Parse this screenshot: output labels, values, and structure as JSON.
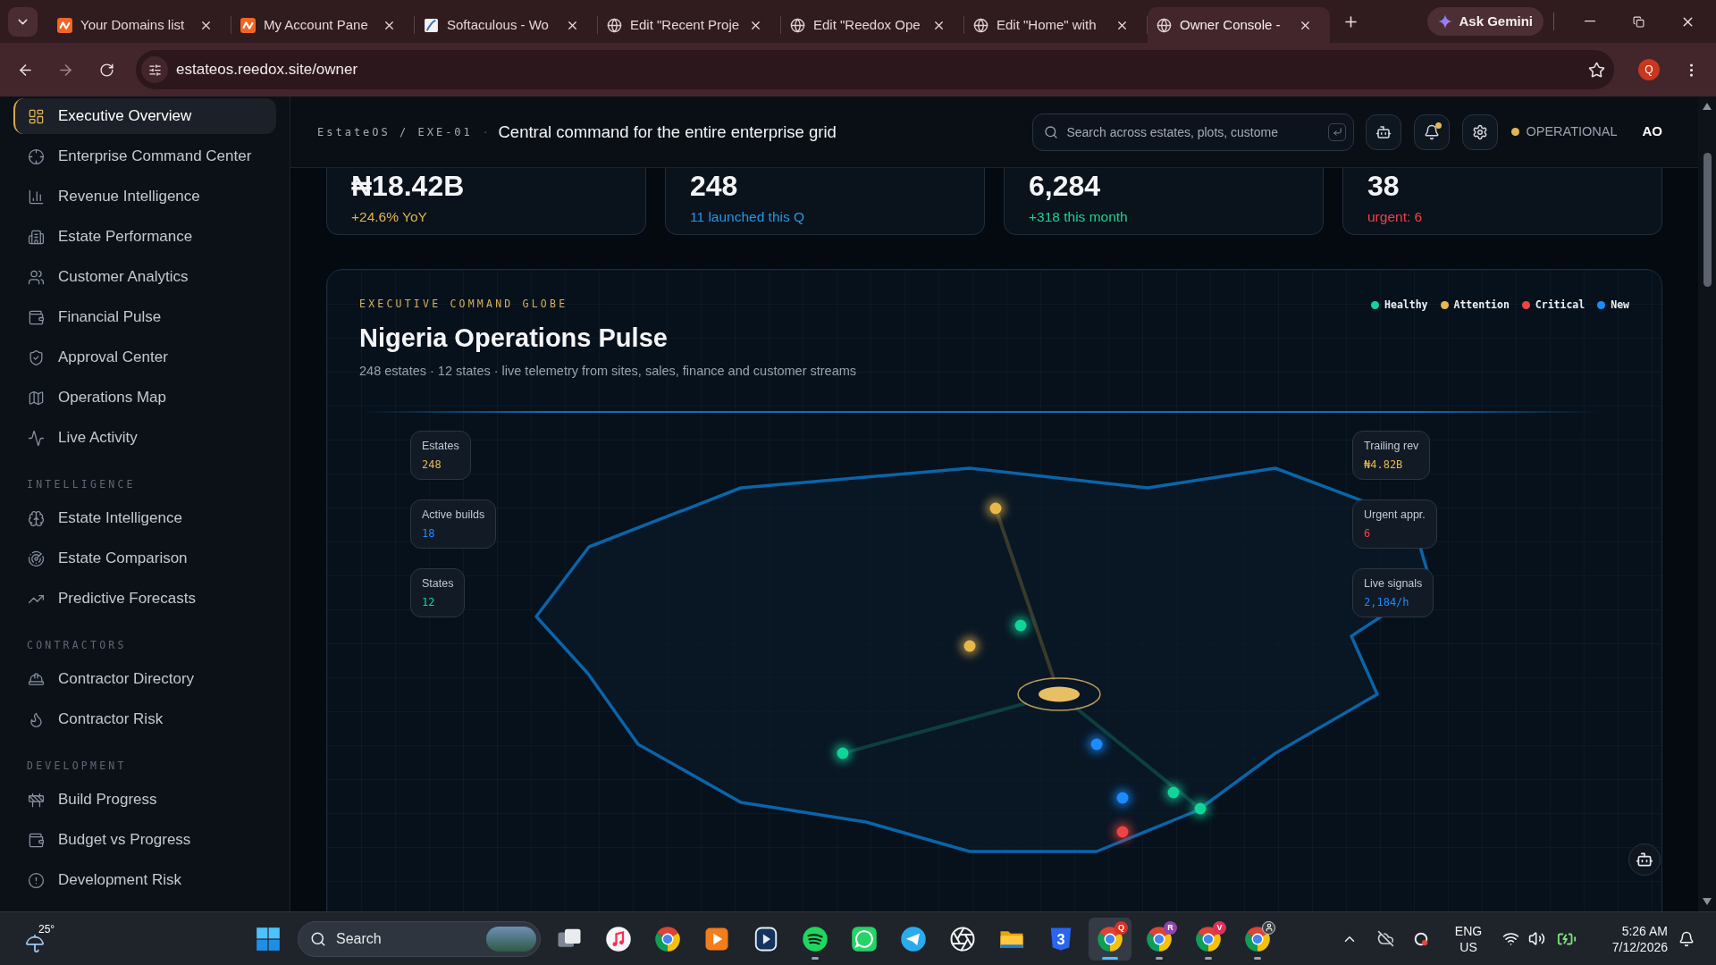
{
  "browser": {
    "tabs": [
      {
        "title": "Your Domains list",
        "kind": "logo",
        "selected": false
      },
      {
        "title": "My Account Pane",
        "kind": "logo",
        "selected": false
      },
      {
        "title": "Softaculous - Wo",
        "kind": "document",
        "selected": false
      },
      {
        "title": "Edit \"Recent Proje",
        "kind": "globe",
        "selected": false
      },
      {
        "title": "Edit \"Reedox Ope",
        "kind": "globe",
        "selected": false
      },
      {
        "title": "Edit \"Home\" with",
        "kind": "globe",
        "selected": false
      },
      {
        "title": "Owner Console -",
        "kind": "globe",
        "selected": true
      }
    ],
    "assistant": "Ask Gemini",
    "url": "estateos.reedox.site/owner",
    "profile": "Q"
  },
  "sidebar": {
    "groups": [
      {
        "items": [
          {
            "label": "Executive Overview",
            "selected": true
          },
          {
            "label": "Enterprise Command Center",
            "selected": false
          },
          {
            "label": "Revenue Intelligence",
            "selected": false
          },
          {
            "label": "Estate Performance",
            "selected": false
          },
          {
            "label": "Customer Analytics",
            "selected": false
          },
          {
            "label": "Financial Pulse",
            "selected": false
          },
          {
            "label": "Approval Center",
            "selected": false
          },
          {
            "label": "Operations Map",
            "selected": false
          },
          {
            "label": "Live Activity",
            "selected": false
          }
        ]
      },
      {
        "heading": "INTELLIGENCE",
        "items": [
          {
            "label": "Estate Intelligence",
            "selected": false
          },
          {
            "label": "Estate Comparison",
            "selected": false
          },
          {
            "label": "Predictive Forecasts",
            "selected": false
          }
        ]
      },
      {
        "heading": "CONTRACTORS",
        "items": [
          {
            "label": "Contractor Directory",
            "selected": false
          },
          {
            "label": "Contractor Risk",
            "selected": false
          }
        ]
      },
      {
        "heading": "DEVELOPMENT",
        "items": [
          {
            "label": "Build Progress",
            "selected": false
          },
          {
            "label": "Budget vs Progress",
            "selected": false
          },
          {
            "label": "Development Risk",
            "selected": false
          }
        ]
      }
    ]
  },
  "header": {
    "breadcrumb": "EstateOS / EXE-01",
    "separator": "·",
    "title": "Central command for the entire enterprise grid",
    "search": {
      "placeholder": "Search across estates, plots, custome"
    },
    "unread_alerts": true,
    "status": "OPERATIONAL",
    "user": "AO"
  },
  "stats": [
    {
      "value": "₦18.42B",
      "note": "+24.6% YoY",
      "color": "#e0b550"
    },
    {
      "value": "248",
      "note": "11 launched this Q",
      "color": "#2299e6"
    },
    {
      "value": "6,284",
      "note": "+318 this month",
      "color": "#1ed28f"
    },
    {
      "value": "38",
      "note": "urgent: 6",
      "color": "#ef4444"
    }
  ],
  "globe": {
    "eyebrow": "EXECUTIVE COMMAND GLOBE",
    "title": "Nigeria Operations Pulse",
    "subtitle": "248 estates · 12 states · live telemetry from sites, sales, finance and customer streams",
    "legend": [
      {
        "label": "Healthy",
        "color": "#10d49a"
      },
      {
        "label": "Attention",
        "color": "#e8b84a"
      },
      {
        "label": "Critical",
        "color": "#ef4444"
      },
      {
        "label": "New",
        "color": "#1a8cff"
      }
    ],
    "chips_left": [
      {
        "label": "Estates",
        "value": "248",
        "color": "#e8b84a"
      },
      {
        "label": "Active builds",
        "value": "18",
        "color": "#1a8cff"
      },
      {
        "label": "States",
        "value": "12",
        "color": "#10d49a"
      }
    ],
    "chips_right": [
      {
        "label": "Trailing rev",
        "value": "₦4.82B",
        "color": "#e8b84a"
      },
      {
        "label": "Urgent appr.",
        "value": "6",
        "color": "#ef4444"
      },
      {
        "label": "Live signals",
        "value": "2,184/h",
        "color": "#1a8cff"
      }
    ],
    "markers": [
      {
        "color": "#e8b84a"
      },
      {
        "color": "#10d49a"
      },
      {
        "color": "#e8b84a"
      },
      {
        "color": "#1a8cff"
      },
      {
        "color": "#10d49a"
      },
      {
        "color": "#10d49a"
      },
      {
        "color": "#1a8cff"
      },
      {
        "color": "#10d49a"
      },
      {
        "color": "#ef4444"
      }
    ]
  },
  "taskbar": {
    "weather": "25°",
    "search": {
      "placeholder": "Search"
    },
    "apps": [
      {
        "kind": "taskview",
        "running": false,
        "selected": false
      },
      {
        "kind": "music",
        "running": false,
        "selected": false
      },
      {
        "kind": "browser",
        "running": false,
        "selected": false
      },
      {
        "kind": "media",
        "running": false,
        "selected": false
      },
      {
        "kind": "player",
        "running": false,
        "selected": false
      },
      {
        "kind": "audio",
        "running": true,
        "selected": false
      },
      {
        "kind": "chat",
        "running": false,
        "selected": false
      },
      {
        "kind": "messenger",
        "running": false,
        "selected": false
      },
      {
        "kind": "assistant",
        "running": false,
        "selected": false
      },
      {
        "kind": "files",
        "running": false,
        "selected": false
      },
      {
        "kind": "editor",
        "label": "3",
        "running": false,
        "selected": false
      },
      {
        "kind": "profile",
        "badge": "Q",
        "color": "#d93025",
        "running": true,
        "selected": true
      },
      {
        "kind": "profile",
        "badge": "R",
        "color": "#8e44ad",
        "running": true,
        "selected": false
      },
      {
        "kind": "profile",
        "badge": "V",
        "color": "#e0305a",
        "running": true,
        "selected": false
      },
      {
        "kind": "guest",
        "running": true,
        "selected": false
      }
    ],
    "language": "ENG",
    "region": "US",
    "time": "5:26 AM",
    "date": "7/12/2026"
  }
}
